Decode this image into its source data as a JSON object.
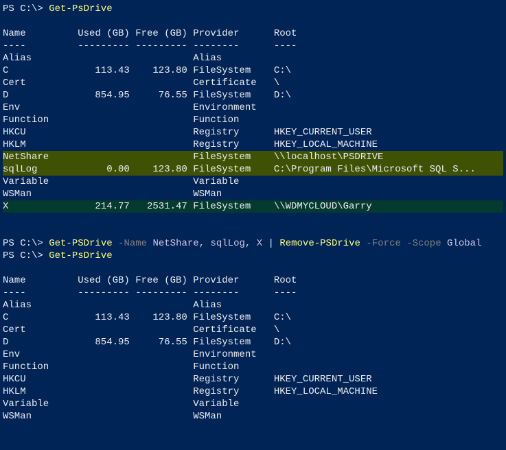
{
  "prompts": {
    "ps_prefix": "PS C:\\> ",
    "cmd_getpsdrive": "Get-PsDrive",
    "cmd_getpsdrive2": "Get-PSDrive",
    "cmd_removepsdrive": "Remove-PSDrive",
    "param_name": "-Name",
    "arg_names": "NetShare, sqlLog, X",
    "pipe": " | ",
    "param_force": "-Force",
    "param_scope": "-Scope",
    "arg_scope": "Global"
  },
  "headers": {
    "name": "Name",
    "used": "Used (GB)",
    "free": "Free (GB)",
    "provider": "Provider",
    "root": "Root",
    "dash_name": "----",
    "dash_used": "---------",
    "dash_free": "---------",
    "dash_prov": "--------",
    "dash_root": "----"
  },
  "table1": [
    {
      "name": "Alias",
      "used": "",
      "free": "",
      "provider": "Alias",
      "root": "",
      "hl": ""
    },
    {
      "name": "C",
      "used": "113.43",
      "free": "123.80",
      "provider": "FileSystem",
      "root": "C:\\",
      "hl": ""
    },
    {
      "name": "Cert",
      "used": "",
      "free": "",
      "provider": "Certificate",
      "root": "\\",
      "hl": ""
    },
    {
      "name": "D",
      "used": "854.95",
      "free": "76.55",
      "provider": "FileSystem",
      "root": "D:\\",
      "hl": ""
    },
    {
      "name": "Env",
      "used": "",
      "free": "",
      "provider": "Environment",
      "root": "",
      "hl": ""
    },
    {
      "name": "Function",
      "used": "",
      "free": "",
      "provider": "Function",
      "root": "",
      "hl": ""
    },
    {
      "name": "HKCU",
      "used": "",
      "free": "",
      "provider": "Registry",
      "root": "HKEY_CURRENT_USER",
      "hl": ""
    },
    {
      "name": "HKLM",
      "used": "",
      "free": "",
      "provider": "Registry",
      "root": "HKEY_LOCAL_MACHINE",
      "hl": ""
    },
    {
      "name": "NetShare",
      "used": "",
      "free": "",
      "provider": "FileSystem",
      "root": "\\\\localhost\\PSDRIVE",
      "hl": "hl1"
    },
    {
      "name": "sqlLog",
      "used": "0.00",
      "free": "123.80",
      "provider": "FileSystem",
      "root": "C:\\Program Files\\Microsoft SQL S...",
      "hl": "hl1"
    },
    {
      "name": "Variable",
      "used": "",
      "free": "",
      "provider": "Variable",
      "root": "",
      "hl": ""
    },
    {
      "name": "WSMan",
      "used": "",
      "free": "",
      "provider": "WSMan",
      "root": "",
      "hl": ""
    },
    {
      "name": "X",
      "used": "214.77",
      "free": "2531.47",
      "provider": "FileSystem",
      "root": "\\\\WDMYCLOUD\\Garry",
      "hl": "hl2"
    }
  ],
  "table2": [
    {
      "name": "Alias",
      "used": "",
      "free": "",
      "provider": "Alias",
      "root": ""
    },
    {
      "name": "C",
      "used": "113.43",
      "free": "123.80",
      "provider": "FileSystem",
      "root": "C:\\"
    },
    {
      "name": "Cert",
      "used": "",
      "free": "",
      "provider": "Certificate",
      "root": "\\"
    },
    {
      "name": "D",
      "used": "854.95",
      "free": "76.55",
      "provider": "FileSystem",
      "root": "D:\\"
    },
    {
      "name": "Env",
      "used": "",
      "free": "",
      "provider": "Environment",
      "root": ""
    },
    {
      "name": "Function",
      "used": "",
      "free": "",
      "provider": "Function",
      "root": ""
    },
    {
      "name": "HKCU",
      "used": "",
      "free": "",
      "provider": "Registry",
      "root": "HKEY_CURRENT_USER"
    },
    {
      "name": "HKLM",
      "used": "",
      "free": "",
      "provider": "Registry",
      "root": "HKEY_LOCAL_MACHINE"
    },
    {
      "name": "Variable",
      "used": "",
      "free": "",
      "provider": "Variable",
      "root": ""
    },
    {
      "name": "WSMan",
      "used": "",
      "free": "",
      "provider": "WSMan",
      "root": ""
    }
  ]
}
